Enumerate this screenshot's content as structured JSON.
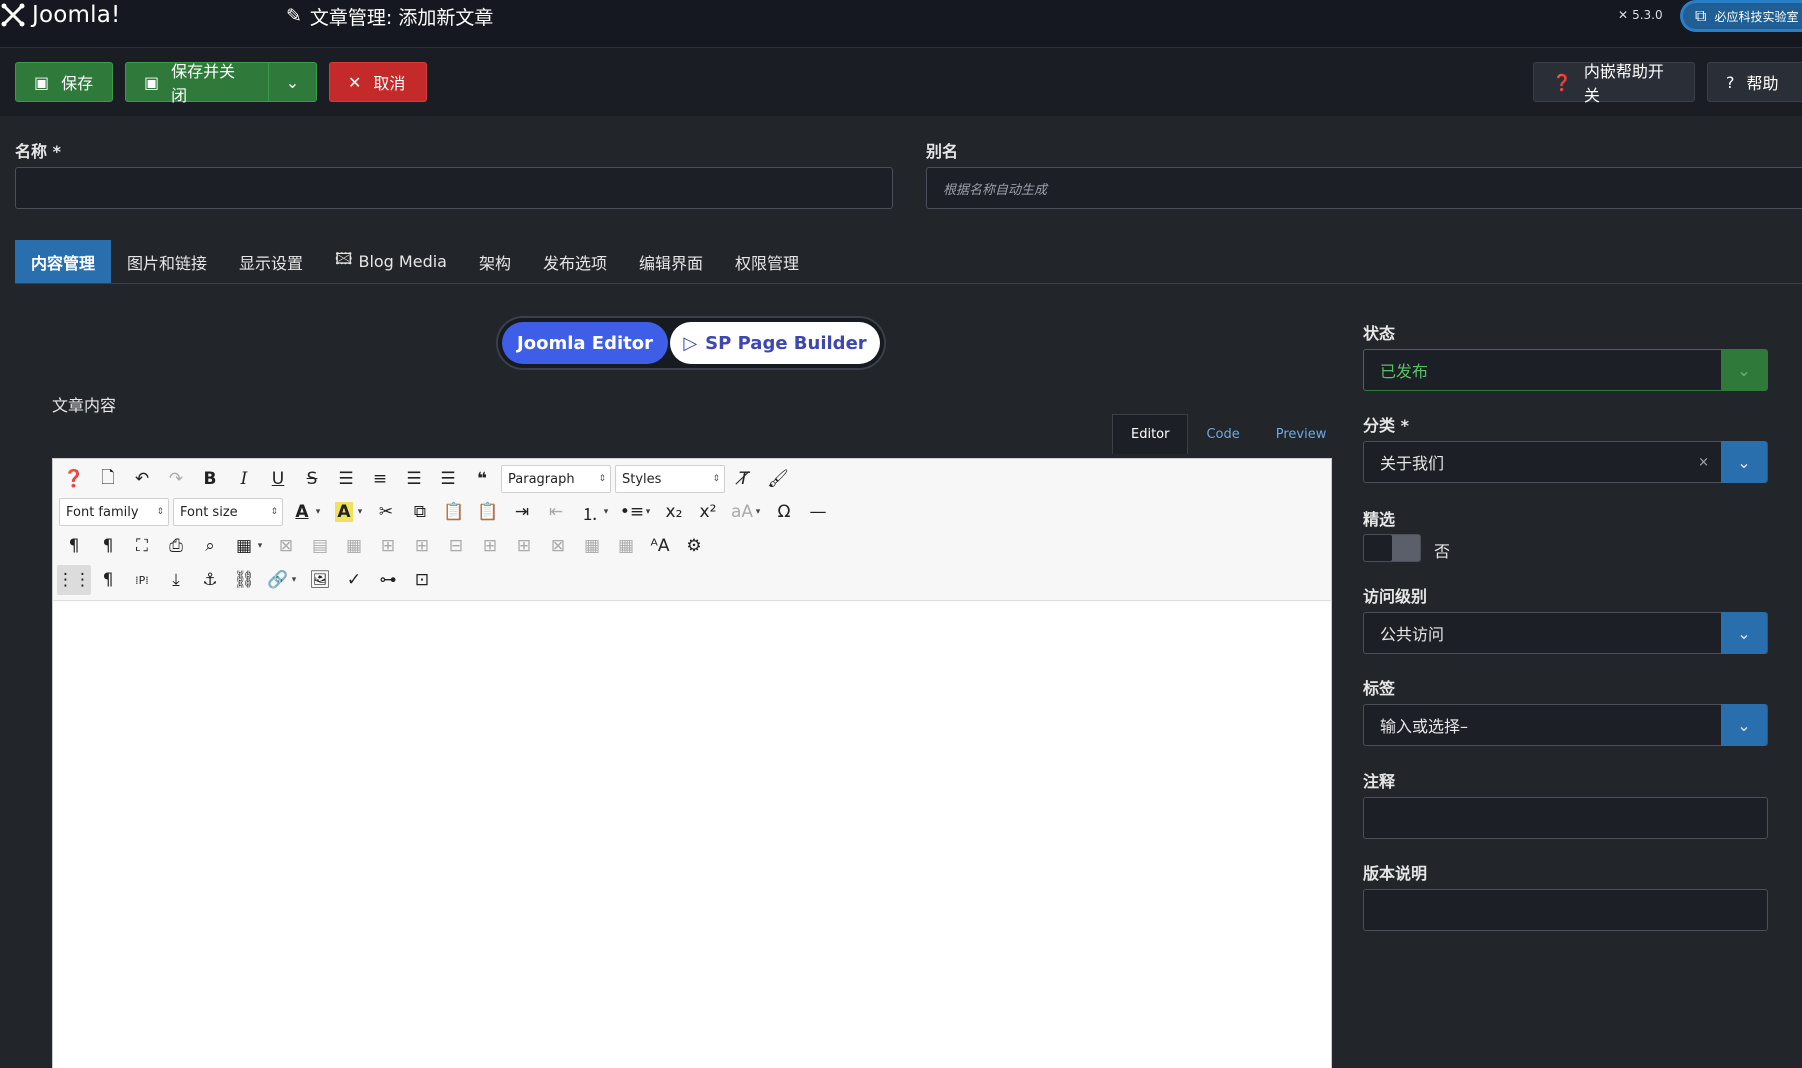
{
  "header": {
    "logo_text": "Joomla!",
    "page_title": "文章管理: 添加新文章",
    "version": "5.3.0",
    "site_link": "必应科技实验室"
  },
  "toolbar": {
    "save_label": "保存",
    "save_close_label": "保存并关闭",
    "cancel_label": "取消",
    "inline_help_label": "内嵌帮助开关",
    "help_label": "帮助"
  },
  "form": {
    "title_label": "名称 *",
    "title_value": "",
    "alias_label": "别名",
    "alias_placeholder": "根据名称自动生成"
  },
  "tabs": [
    {
      "label": "内容管理",
      "active": true
    },
    {
      "label": "图片和链接"
    },
    {
      "label": "显示设置"
    },
    {
      "label": "Blog Media"
    },
    {
      "label": "架构"
    },
    {
      "label": "发布选项"
    },
    {
      "label": "编辑界面"
    },
    {
      "label": "权限管理"
    }
  ],
  "editor_switch": {
    "joomla": "Joomla Editor",
    "sppb": "SP Page Builder"
  },
  "content_label": "文章内容",
  "editor_views": [
    "Editor",
    "Code",
    "Preview"
  ],
  "editor": {
    "block_format": "Paragraph",
    "styles": "Styles",
    "font_family": "Font family",
    "font_size": "Font size"
  },
  "sidebar": {
    "status_label": "状态",
    "status_value": "已发布",
    "category_label": "分类 *",
    "category_value": "关于我们",
    "featured_label": "精选",
    "featured_value": "否",
    "access_label": "访问级别",
    "access_value": "公共访问",
    "tags_label": "标签",
    "tags_placeholder": "输入或选择–",
    "note_label": "注释",
    "version_note_label": "版本说明"
  },
  "colors": {
    "accent": "#2a6fad",
    "save": "#2f7a3b",
    "cancel": "#c52a2a",
    "joomla_editor": "#3e5ee8"
  }
}
